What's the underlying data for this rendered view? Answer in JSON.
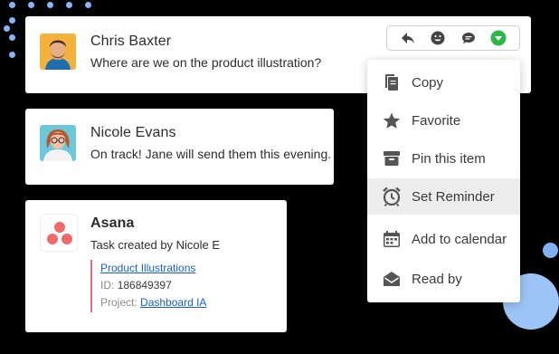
{
  "messages": [
    {
      "author": "Chris Baxter",
      "text": "Where are we on the product illustration?"
    },
    {
      "author": "Nicole Evans",
      "text": "On track! Jane will send them this evening."
    }
  ],
  "asana_card": {
    "app_name": "Asana",
    "task_text": "Task created by Nicole E",
    "task_link": "Product Illustrations",
    "id_label": "ID:",
    "id_value": "186849397",
    "project_label": "Project:",
    "project_link": "Dashboard IA"
  },
  "toolbar": {
    "icons": [
      "reply-icon",
      "emoji-icon",
      "comment-icon",
      "more-dropdown-icon"
    ]
  },
  "menu": {
    "items": [
      {
        "label": "Copy",
        "icon": "copy-icon"
      },
      {
        "label": "Favorite",
        "icon": "star-icon"
      },
      {
        "label": "Pin this item",
        "icon": "archive-box-icon"
      },
      {
        "label": "Set Reminder",
        "icon": "alarm-clock-icon"
      },
      {
        "label": "Add to calendar",
        "icon": "calendar-icon"
      },
      {
        "label": "Read by",
        "icon": "open-envelope-icon"
      }
    ],
    "active_index": 3
  },
  "colors": {
    "accent_green": "#2fb84a",
    "link_blue": "#1a5fcc",
    "asana_red": "#f06a6a",
    "menu_highlight": "#ededed",
    "decor_blue": "#9cc4f6"
  }
}
